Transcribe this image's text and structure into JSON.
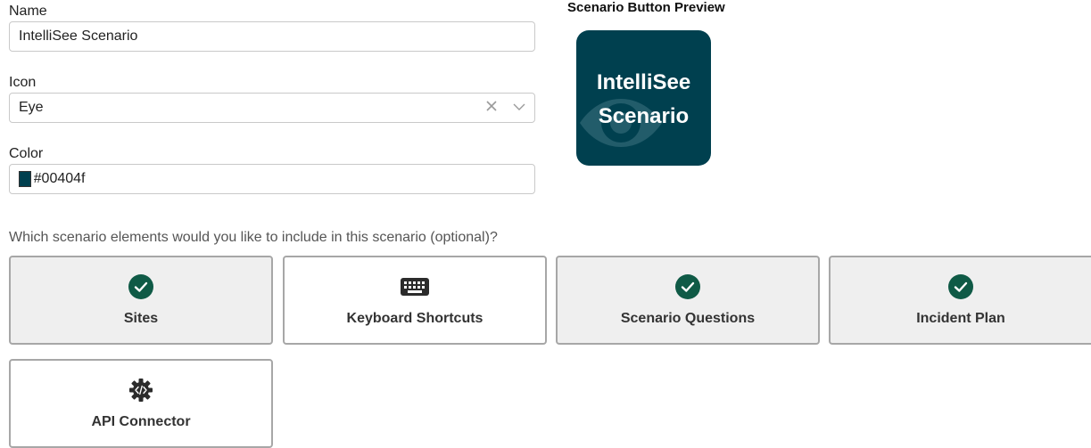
{
  "form": {
    "name_label": "Name",
    "name_value": "IntelliSee Scenario",
    "icon_label": "Icon",
    "icon_value": "Eye",
    "color_label": "Color",
    "color_value": "#00404f"
  },
  "preview": {
    "label": "Scenario Button Preview",
    "line1": "IntelliSee",
    "line2": "Scenario",
    "icon": "eye-icon",
    "background": "#00404f"
  },
  "elements": {
    "question": "Which scenario elements would you like to include in this scenario (optional)?",
    "items": [
      {
        "label": "Sites",
        "selected": true,
        "icon": "check-circle-icon"
      },
      {
        "label": "Keyboard Shortcuts",
        "selected": false,
        "icon": "keyboard-icon"
      },
      {
        "label": "Scenario Questions",
        "selected": true,
        "icon": "check-circle-icon"
      },
      {
        "label": "Incident Plan",
        "selected": true,
        "icon": "check-circle-icon"
      },
      {
        "label": "API Connector",
        "selected": false,
        "icon": "code-gear-icon"
      }
    ]
  },
  "colors": {
    "check_green": "#0f5a46",
    "tile_border": "#a7a7a7",
    "selected_bg": "#efefef"
  }
}
